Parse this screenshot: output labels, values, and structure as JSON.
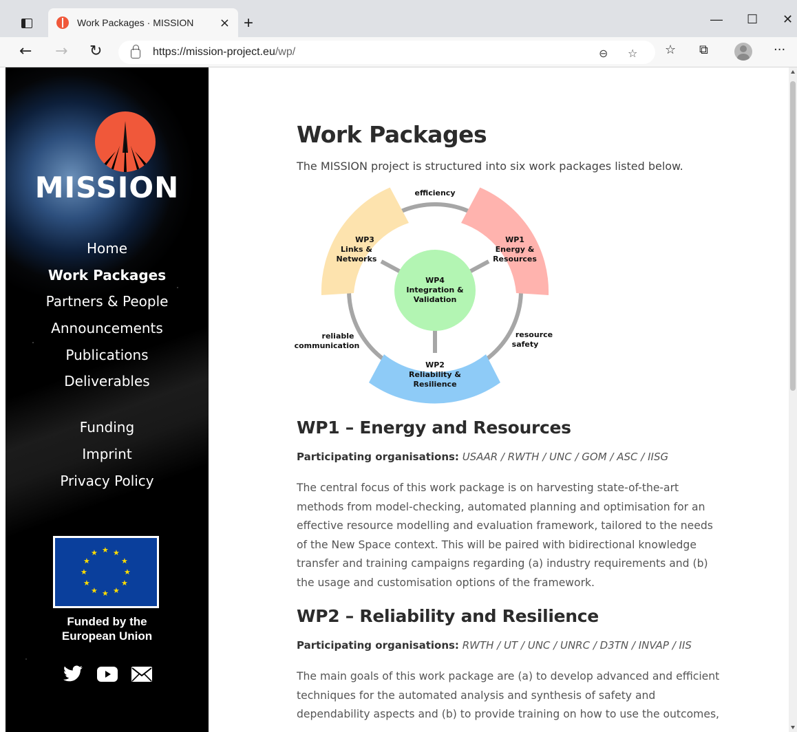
{
  "browser": {
    "tab_title": "Work Packages · MISSION",
    "tab_close": "×",
    "new_tab": "+",
    "url_host": "https://mission-project.eu",
    "url_path": "/wp/",
    "controls": {
      "minimize": "—",
      "maximize": "☐",
      "close": "✕"
    }
  },
  "sidebar": {
    "logo_text": "MISSION",
    "nav": [
      "Home",
      "Work Packages",
      "Partners & People",
      "Announcements",
      "Publications",
      "Deliverables"
    ],
    "nav_active": "Work Packages",
    "secondary_nav": [
      "Funding",
      "Imprint",
      "Privacy Policy"
    ],
    "funded_line1": "Funded by the",
    "funded_line2": "European Union",
    "social": [
      "twitter-icon",
      "youtube-icon",
      "mail-icon"
    ]
  },
  "page": {
    "title": "Work Packages",
    "intro": "The MISSION project is structured into six work packages listed below."
  },
  "diagram": {
    "center": [
      "WP4",
      "Integration &",
      "Validation"
    ],
    "wp1": [
      "WP1",
      "Energy &",
      "Resources"
    ],
    "wp2": [
      "WP2",
      "Reliability &",
      "Resilience"
    ],
    "wp3": [
      "WP3",
      "Links &",
      "Networks"
    ],
    "label_top": "efficiency",
    "label_left": [
      "reliable",
      "communication"
    ],
    "label_right": [
      "resource",
      "safety"
    ],
    "colors": {
      "wp1": "#ffb3ae",
      "wp2": "#8ecbf7",
      "wp3": "#fde3ae",
      "wp4": "#b3f5b3",
      "ring": "#a6a6a6"
    }
  },
  "sections": [
    {
      "heading": "WP1 – Energy and Resources",
      "orgs_label": "Participating organisations:",
      "orgs": "USAAR / RWTH / UNC / GOM / ASC / IISG",
      "body": "The central focus of this work package is on harvesting state-of-the-art methods from model-checking, automated planning and optimisation for an effective resource modelling and evaluation framework, tailored to the needs of the New Space context. This will be paired with bidirectional knowledge transfer and training campaigns regarding (a) industry requirements and (b) the usage and customisation options of the framework."
    },
    {
      "heading": "WP2 – Reliability and Resilience",
      "orgs_label": "Participating organisations:",
      "orgs": "RWTH / UT / UNC / UNRC / D3TN / INVAP / IIS",
      "body": "The main goals of this work package are (a) to develop advanced and efficient techniques for the automated analysis and synthesis of safety and dependability aspects and (b) to provide training on how to use the outcomes,"
    }
  ]
}
